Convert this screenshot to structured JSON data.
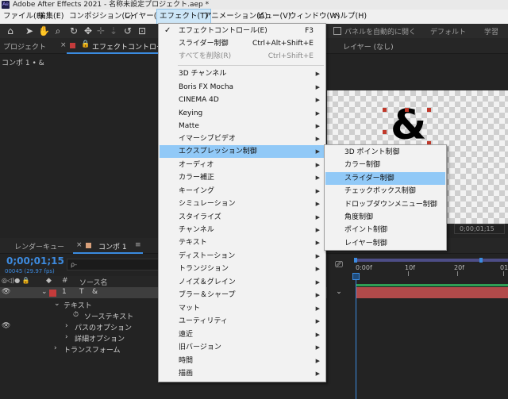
{
  "window": {
    "title": "Adobe After Effects 2021 - 名称未設定プロジェクト.aep *",
    "logo_text": "Ae"
  },
  "menubar": {
    "items": [
      {
        "label": "ファイル(F)"
      },
      {
        "label": "編集(E)"
      },
      {
        "label": "コンポジション(C)"
      },
      {
        "label": "レイヤー(L)"
      },
      {
        "label": "エフェクト(T)"
      },
      {
        "label": "アニメーション(A)"
      },
      {
        "label": "ビュー(V)"
      },
      {
        "label": "ウィンドウ(W)"
      },
      {
        "label": "ヘルプ(H)"
      }
    ]
  },
  "toolbar": {
    "auto_open_label": "パネルを自動的に開く",
    "workspaces": [
      "デフォルト",
      "学習"
    ]
  },
  "panels": {
    "project_tab": "プロジェクト",
    "effect_controls_tab": "エフェクトコントロール",
    "layer_tab": "レイヤー (なし)",
    "breadcrumb": "コンポ 1 • &"
  },
  "viewer": {
    "glyph": "&",
    "timecode": "0;00;01;15"
  },
  "timeline": {
    "render_queue_tab": "レンダーキュー",
    "comp_tab": "コンポ 1",
    "current_time": "0;00;01;15",
    "frame_info": "00045 (29.97 fps)",
    "search_placeholder": "ρ-",
    "columns": {
      "hash": "#",
      "source_name": "ソース名"
    },
    "layers": [
      {
        "num": "1",
        "type": "T",
        "name": "&"
      }
    ],
    "properties": [
      {
        "label": "テキスト"
      },
      {
        "label": "ソーステキスト"
      },
      {
        "label": "パスのオプション"
      },
      {
        "label": "詳細オプション"
      },
      {
        "label": "トランスフォーム"
      }
    ],
    "ruler_labels": [
      "0:00f",
      "10f",
      "20f",
      "01"
    ]
  },
  "effect_menu": {
    "items": [
      {
        "label": "エフェクトコントロール(E)",
        "shortcut": "F3",
        "checked": true
      },
      {
        "label": "スライダー制御",
        "shortcut": "Ctrl+Alt+Shift+E"
      },
      {
        "label": "すべてを削除(R)",
        "shortcut": "Ctrl+Shift+E",
        "disabled": true
      },
      {
        "label": "3D チャンネル"
      },
      {
        "label": "Boris FX Mocha"
      },
      {
        "label": "CINEMA 4D"
      },
      {
        "label": "Keying"
      },
      {
        "label": "Matte"
      },
      {
        "label": "イマーシブビデオ"
      },
      {
        "label": "エクスプレッション制御"
      },
      {
        "label": "オーディオ"
      },
      {
        "label": "カラー補正"
      },
      {
        "label": "キーイング"
      },
      {
        "label": "シミュレーション"
      },
      {
        "label": "スタイライズ"
      },
      {
        "label": "チャンネル"
      },
      {
        "label": "テキスト"
      },
      {
        "label": "ディストーション"
      },
      {
        "label": "トランジション"
      },
      {
        "label": "ノイズ＆グレイン"
      },
      {
        "label": "ブラー＆シャープ"
      },
      {
        "label": "マット"
      },
      {
        "label": "ユーティリティ"
      },
      {
        "label": "遠近"
      },
      {
        "label": "旧バージョン"
      },
      {
        "label": "時間"
      },
      {
        "label": "描画"
      }
    ]
  },
  "expression_submenu": {
    "items": [
      {
        "label": "3D ポイント制御"
      },
      {
        "label": "カラー制御"
      },
      {
        "label": "スライダー制御"
      },
      {
        "label": "チェックボックス制御"
      },
      {
        "label": "ドロップダウンメニュー制御"
      },
      {
        "label": "角度制御"
      },
      {
        "label": "ポイント制御"
      },
      {
        "label": "レイヤー制御"
      }
    ]
  },
  "colors": {
    "accent": "#3b8be0",
    "menu_highlight": "#91c9f7",
    "layer_bar": "#b24a4a"
  }
}
